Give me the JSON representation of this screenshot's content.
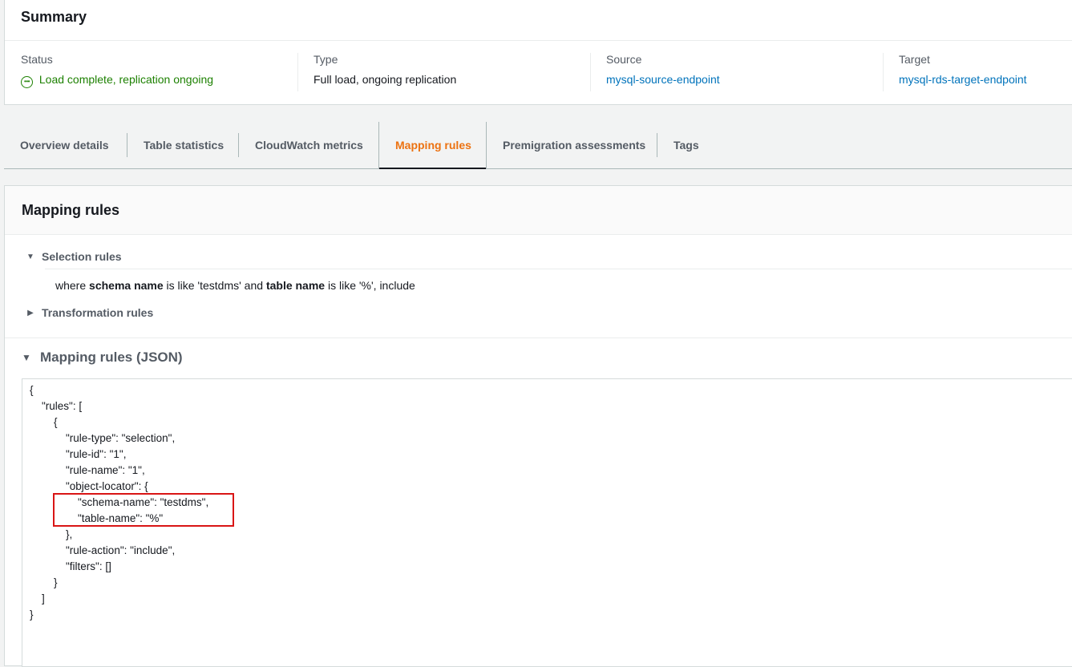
{
  "summary": {
    "title": "Summary",
    "status_label": "Status",
    "status_value": "Load complete, replication ongoing",
    "type_label": "Type",
    "type_value": "Full load, ongoing replication",
    "source_label": "Source",
    "source_value": "mysql-source-endpoint",
    "target_label": "Target",
    "target_value": "mysql-rds-target-endpoint"
  },
  "tabs": [
    {
      "label": "Overview details"
    },
    {
      "label": "Table statistics"
    },
    {
      "label": "CloudWatch metrics"
    },
    {
      "label": "Mapping rules",
      "active": true
    },
    {
      "label": "Premigration assessments"
    },
    {
      "label": "Tags"
    }
  ],
  "mapping": {
    "title": "Mapping rules",
    "selection_label": "Selection rules",
    "selection_rule": {
      "p1": "where ",
      "b1": "schema name",
      "p2": " is like 'testdms' and ",
      "b2": "table name",
      "p3": " is like '%', include"
    },
    "transformation_label": "Transformation rules",
    "json_title": "Mapping rules (JSON)",
    "json_lines": [
      "{",
      "\"rules\": [",
      "{",
      "\"rule-type\": \"selection\",",
      "\"rule-id\": \"1\",",
      "\"rule-name\": \"1\",",
      "\"object-locator\": {",
      "\"schema-name\": \"testdms\",",
      "\"table-name\": \"%\"",
      "},",
      "\"rule-action\": \"include\",",
      "\"filters\": []",
      "}",
      "]",
      "}"
    ]
  },
  "colors": {
    "accent": "#ec7211",
    "link": "#0073bb",
    "success": "#1d8102",
    "highlight": "#d91515"
  }
}
